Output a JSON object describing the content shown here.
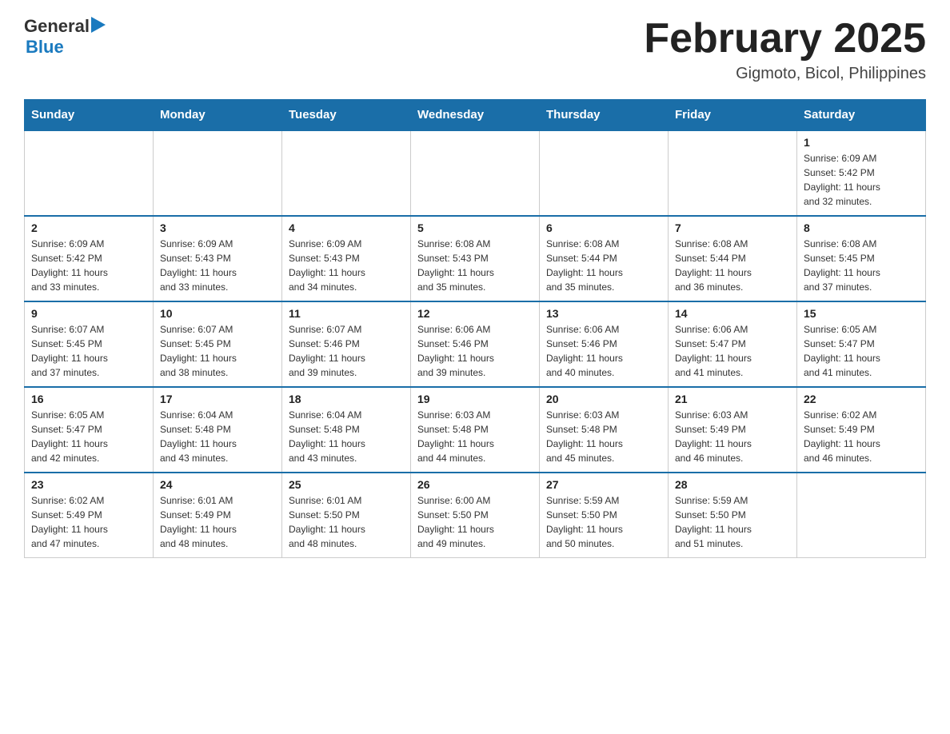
{
  "logo": {
    "general": "General",
    "blue": "Blue",
    "arrow": "▶"
  },
  "header": {
    "month": "February 2025",
    "location": "Gigmoto, Bicol, Philippines"
  },
  "weekdays": [
    "Sunday",
    "Monday",
    "Tuesday",
    "Wednesday",
    "Thursday",
    "Friday",
    "Saturday"
  ],
  "weeks": [
    [
      {
        "day": "",
        "info": ""
      },
      {
        "day": "",
        "info": ""
      },
      {
        "day": "",
        "info": ""
      },
      {
        "day": "",
        "info": ""
      },
      {
        "day": "",
        "info": ""
      },
      {
        "day": "",
        "info": ""
      },
      {
        "day": "1",
        "info": "Sunrise: 6:09 AM\nSunset: 5:42 PM\nDaylight: 11 hours\nand 32 minutes."
      }
    ],
    [
      {
        "day": "2",
        "info": "Sunrise: 6:09 AM\nSunset: 5:42 PM\nDaylight: 11 hours\nand 33 minutes."
      },
      {
        "day": "3",
        "info": "Sunrise: 6:09 AM\nSunset: 5:43 PM\nDaylight: 11 hours\nand 33 minutes."
      },
      {
        "day": "4",
        "info": "Sunrise: 6:09 AM\nSunset: 5:43 PM\nDaylight: 11 hours\nand 34 minutes."
      },
      {
        "day": "5",
        "info": "Sunrise: 6:08 AM\nSunset: 5:43 PM\nDaylight: 11 hours\nand 35 minutes."
      },
      {
        "day": "6",
        "info": "Sunrise: 6:08 AM\nSunset: 5:44 PM\nDaylight: 11 hours\nand 35 minutes."
      },
      {
        "day": "7",
        "info": "Sunrise: 6:08 AM\nSunset: 5:44 PM\nDaylight: 11 hours\nand 36 minutes."
      },
      {
        "day": "8",
        "info": "Sunrise: 6:08 AM\nSunset: 5:45 PM\nDaylight: 11 hours\nand 37 minutes."
      }
    ],
    [
      {
        "day": "9",
        "info": "Sunrise: 6:07 AM\nSunset: 5:45 PM\nDaylight: 11 hours\nand 37 minutes."
      },
      {
        "day": "10",
        "info": "Sunrise: 6:07 AM\nSunset: 5:45 PM\nDaylight: 11 hours\nand 38 minutes."
      },
      {
        "day": "11",
        "info": "Sunrise: 6:07 AM\nSunset: 5:46 PM\nDaylight: 11 hours\nand 39 minutes."
      },
      {
        "day": "12",
        "info": "Sunrise: 6:06 AM\nSunset: 5:46 PM\nDaylight: 11 hours\nand 39 minutes."
      },
      {
        "day": "13",
        "info": "Sunrise: 6:06 AM\nSunset: 5:46 PM\nDaylight: 11 hours\nand 40 minutes."
      },
      {
        "day": "14",
        "info": "Sunrise: 6:06 AM\nSunset: 5:47 PM\nDaylight: 11 hours\nand 41 minutes."
      },
      {
        "day": "15",
        "info": "Sunrise: 6:05 AM\nSunset: 5:47 PM\nDaylight: 11 hours\nand 41 minutes."
      }
    ],
    [
      {
        "day": "16",
        "info": "Sunrise: 6:05 AM\nSunset: 5:47 PM\nDaylight: 11 hours\nand 42 minutes."
      },
      {
        "day": "17",
        "info": "Sunrise: 6:04 AM\nSunset: 5:48 PM\nDaylight: 11 hours\nand 43 minutes."
      },
      {
        "day": "18",
        "info": "Sunrise: 6:04 AM\nSunset: 5:48 PM\nDaylight: 11 hours\nand 43 minutes."
      },
      {
        "day": "19",
        "info": "Sunrise: 6:03 AM\nSunset: 5:48 PM\nDaylight: 11 hours\nand 44 minutes."
      },
      {
        "day": "20",
        "info": "Sunrise: 6:03 AM\nSunset: 5:48 PM\nDaylight: 11 hours\nand 45 minutes."
      },
      {
        "day": "21",
        "info": "Sunrise: 6:03 AM\nSunset: 5:49 PM\nDaylight: 11 hours\nand 46 minutes."
      },
      {
        "day": "22",
        "info": "Sunrise: 6:02 AM\nSunset: 5:49 PM\nDaylight: 11 hours\nand 46 minutes."
      }
    ],
    [
      {
        "day": "23",
        "info": "Sunrise: 6:02 AM\nSunset: 5:49 PM\nDaylight: 11 hours\nand 47 minutes."
      },
      {
        "day": "24",
        "info": "Sunrise: 6:01 AM\nSunset: 5:49 PM\nDaylight: 11 hours\nand 48 minutes."
      },
      {
        "day": "25",
        "info": "Sunrise: 6:01 AM\nSunset: 5:50 PM\nDaylight: 11 hours\nand 48 minutes."
      },
      {
        "day": "26",
        "info": "Sunrise: 6:00 AM\nSunset: 5:50 PM\nDaylight: 11 hours\nand 49 minutes."
      },
      {
        "day": "27",
        "info": "Sunrise: 5:59 AM\nSunset: 5:50 PM\nDaylight: 11 hours\nand 50 minutes."
      },
      {
        "day": "28",
        "info": "Sunrise: 5:59 AM\nSunset: 5:50 PM\nDaylight: 11 hours\nand 51 minutes."
      },
      {
        "day": "",
        "info": ""
      }
    ]
  ]
}
